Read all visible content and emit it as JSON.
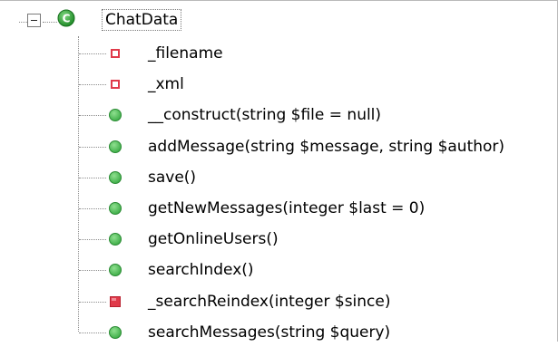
{
  "tree": {
    "root": {
      "label": "ChatData",
      "icon": "class-c-icon",
      "expanded": true,
      "icon_color": "#2e9e35"
    },
    "members": [
      {
        "label": "_filename",
        "kind": "private-property",
        "icon": "private-property-icon"
      },
      {
        "label": "_xml",
        "kind": "private-property",
        "icon": "private-property-icon"
      },
      {
        "label": "__construct(string $file = null)",
        "kind": "public-method",
        "icon": "public-method-icon"
      },
      {
        "label": "addMessage(string $message,  string $author)",
        "kind": "public-method",
        "icon": "public-method-icon"
      },
      {
        "label": "save()",
        "kind": "public-method",
        "icon": "public-method-icon"
      },
      {
        "label": "getNewMessages(integer $last = 0)",
        "kind": "public-method",
        "icon": "public-method-icon"
      },
      {
        "label": "getOnlineUsers()",
        "kind": "public-method",
        "icon": "public-method-icon"
      },
      {
        "label": "searchIndex()",
        "kind": "public-method",
        "icon": "public-method-icon"
      },
      {
        "label": "_searchReindex(integer $since)",
        "kind": "private-method",
        "icon": "private-method-icon"
      },
      {
        "label": "searchMessages(string $query)",
        "kind": "public-method",
        "icon": "public-method-icon"
      }
    ]
  },
  "colors": {
    "public": "#3fae49",
    "private": "#e03a4a",
    "tree_line": "#8c8c8c"
  }
}
